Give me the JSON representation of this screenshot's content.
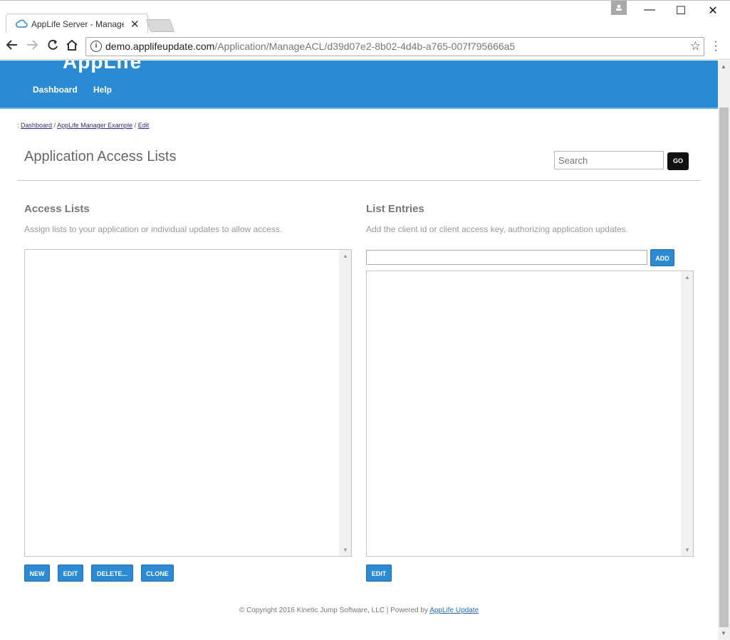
{
  "browser": {
    "tab_title": "AppLife Server - Manage",
    "tab_close": "✕",
    "url_host": "demo.applifeupdate.com",
    "url_path": "/Application/ManageACL/d39d07e2-8b02-4d4b-a765-007f795666a5",
    "icons": [
      "back-arrow-icon",
      "forward-arrow-icon",
      "reload-icon",
      "home-icon",
      "info-icon",
      "star-icon",
      "menu-dots-icon"
    ],
    "window_controls": {
      "minimize": "—",
      "maximize": "☐",
      "close": "✕"
    }
  },
  "header": {
    "logo_text": "AppLife",
    "nav": [
      "Dashboard",
      "Help"
    ],
    "banner_color": "#2a8bd3"
  },
  "breadcrumb": {
    "prefix": ":",
    "items": [
      "Dashboard",
      "AppLife Manager Example",
      "Edit"
    ],
    "separator": "/"
  },
  "page": {
    "title": "Application Access Lists",
    "search_placeholder": "Search",
    "go_label": "GO"
  },
  "access_lists": {
    "title": "Access Lists",
    "description": "Assign lists to your application or individual updates to allow access.",
    "buttons": [
      "NEW",
      "EDIT",
      "DELETE...",
      "CLONE"
    ]
  },
  "list_entries": {
    "title": "List Entries",
    "description": "Add the client id or client access key, authorizing application updates.",
    "add_label": "ADD",
    "edit_label": "EDIT"
  },
  "footer": {
    "text": "© Copyright 2016 Kinetic Jump Software, LLC | Powered by",
    "link": "AppLife Update"
  },
  "colors": {
    "accent": "#2b8ad2",
    "go_button": "#111111"
  }
}
